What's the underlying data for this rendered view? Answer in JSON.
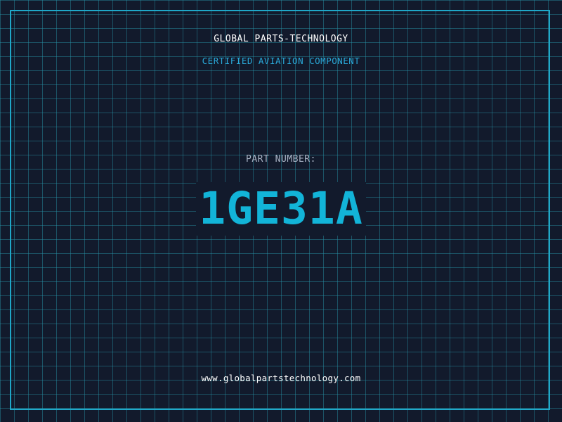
{
  "header": {
    "company_name": "GLOBAL PARTS-TECHNOLOGY",
    "tagline": "CERTIFIED AVIATION COMPONENT"
  },
  "part": {
    "label": "PART NUMBER:",
    "number": "1GE31A"
  },
  "footer": {
    "website": "www.globalpartstechnology.com"
  },
  "colors": {
    "background": "#121a2c",
    "grid": "#2796aa",
    "frame": "#1fa8c9",
    "accent": "#12b4d8",
    "label": "#a9b4c6",
    "text": "#ffffff"
  }
}
